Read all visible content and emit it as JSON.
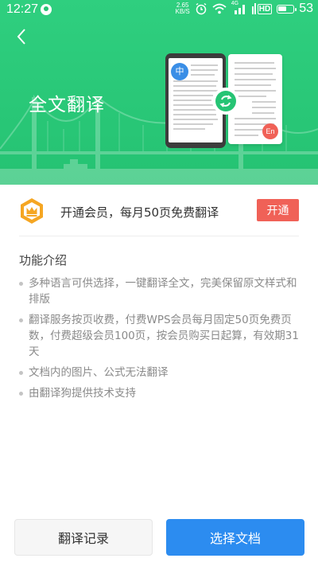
{
  "status_bar": {
    "time": "12:27",
    "net_speed_value": "2.65",
    "net_speed_unit": "KB/S",
    "signal_label": "4G",
    "hd_label": "HD",
    "battery": "53"
  },
  "header": {
    "title": "全文翻译",
    "illustration": {
      "zh_badge": "中",
      "en_badge": "En"
    }
  },
  "promo": {
    "text": "开通会员，每月50页免费翻译",
    "button_label": "开通"
  },
  "features": {
    "title": "功能介绍",
    "items": [
      "多种语言可供选择，一键翻译全文，完美保留原文样式和排版",
      "翻译服务按页收费，付费WPS会员每月固定50页免费页数，付费超级会员100页，按会员购买日起算，有效期31天",
      "文档内的图片、公式无法翻译",
      "由翻译狗提供技术支持"
    ]
  },
  "actions": {
    "history_label": "翻译记录",
    "select_label": "选择文档"
  },
  "colors": {
    "header_green": "#26c474",
    "accent_red": "#f06157",
    "primary_blue": "#2c8cf0",
    "crown_gold": "#f5a623"
  }
}
